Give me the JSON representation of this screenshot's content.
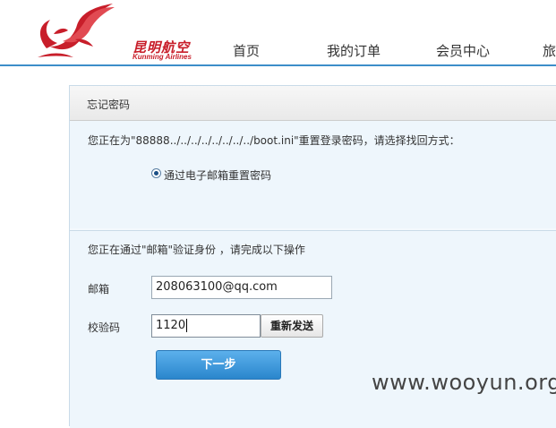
{
  "header": {
    "logo_cn": "昆明航空",
    "logo_en": "Kunming Airlines",
    "nav": [
      {
        "label": "首页"
      },
      {
        "label": "我的订单"
      },
      {
        "label": "会员中心"
      },
      {
        "label": "旅"
      }
    ]
  },
  "panel": {
    "title": "忘记密码",
    "reset_prompt": "您正在为\"88888../../../../../../../../boot.ini\"重置登录密码，请选择找回方式：",
    "method_option": {
      "label": "通过电子邮箱重置密码",
      "selected": true
    },
    "verify_prompt": "您正在通过\"邮箱\"验证身份 ，请完成以下操作",
    "email_label": "邮箱",
    "email_value": "208063100@qq.com",
    "code_label": "校验码",
    "code_value": "1120",
    "resend_label": "重新发送",
    "next_label": "下一步"
  },
  "watermark": "www.wooyun.org",
  "colors": {
    "brand_red": "#c81e2a",
    "header_rule": "#3d8ec9",
    "panel_bg": "#eef6fc",
    "button_blue": "#2a86cc"
  },
  "icons": {
    "logo": "phoenix-logo-icon",
    "radio": "radio-selected-icon"
  }
}
